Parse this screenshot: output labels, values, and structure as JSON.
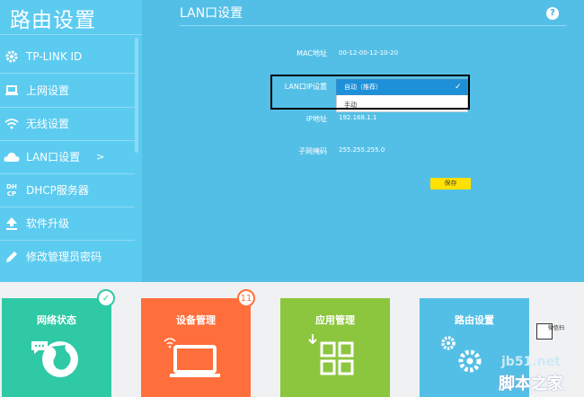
{
  "sidebar": {
    "brand": "路由设置",
    "items": [
      {
        "label": "TP-LINK ID",
        "icon": "gear-icon"
      },
      {
        "label": "上网设置",
        "icon": "laptop-icon"
      },
      {
        "label": "无线设置",
        "icon": "wifi-icon"
      },
      {
        "label": "LAN口设置",
        "icon": "cloud-icon",
        "arrow": ">"
      },
      {
        "label": "DHCP服务器",
        "icon": "dhcp-icon"
      },
      {
        "label": "软件升级",
        "icon": "upload-icon"
      },
      {
        "label": "修改管理员密码",
        "icon": "pencil-icon"
      }
    ]
  },
  "main": {
    "title": "LAN口设置",
    "help": "?",
    "fields": {
      "mac_label": "MAC地址",
      "mac_value": "00-12-00-12-10-20",
      "lanip_label": "LAN口IP设置",
      "lanip_selected": "自动（推荐）",
      "lanip_option": "手动",
      "ip_label": "IP地址",
      "ip_value": "192.168.1.1",
      "mask_label": "子网掩码",
      "mask_value": "255.255.255.0"
    },
    "save_label": "保存"
  },
  "tiles": [
    {
      "label": "网络状态",
      "color": "#2fc9a5",
      "badge": "✓"
    },
    {
      "label": "设备管理",
      "color": "#ff6f3c",
      "badge": "11"
    },
    {
      "label": "应用管理",
      "color": "#8cc63f"
    },
    {
      "label": "路由设置",
      "color": "#54bfe6"
    }
  ],
  "watermark": {
    "line1": "jb51.net",
    "line2": "脚本之家",
    "qr_text": "微信扫"
  }
}
